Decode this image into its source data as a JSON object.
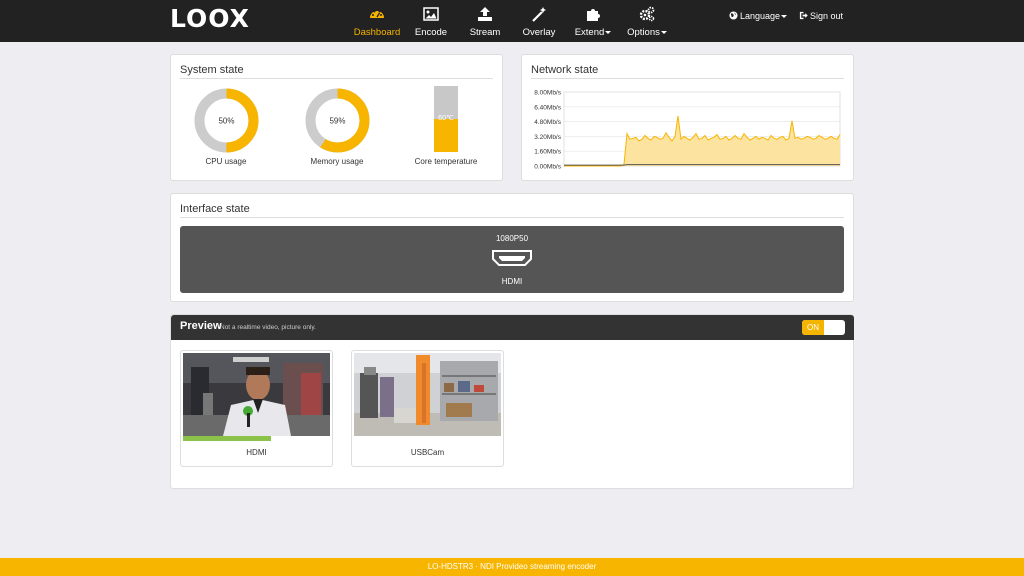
{
  "brand": "LOOX",
  "nav": {
    "items": [
      {
        "label": "Dashboard",
        "icon": "speedometer-icon",
        "active": true
      },
      {
        "label": "Encode",
        "icon": "image-icon"
      },
      {
        "label": "Stream",
        "icon": "upload-icon"
      },
      {
        "label": "Overlay",
        "icon": "magic-wand-icon"
      },
      {
        "label": "Extend",
        "icon": "puzzle-icon",
        "dropdown": true
      },
      {
        "label": "Options",
        "icon": "gears-icon",
        "dropdown": true
      }
    ],
    "language": "Language",
    "signout": "Sign out"
  },
  "system": {
    "title": "System state",
    "cpu": {
      "label": "CPU usage",
      "value": 50,
      "text": "50%"
    },
    "memory": {
      "label": "Memory usage",
      "value": 59,
      "text": "59%"
    },
    "temperature": {
      "label": "Core temperature",
      "text": "60℃",
      "level": 0.5
    }
  },
  "network": {
    "title": "Network state"
  },
  "chart_data": {
    "type": "area",
    "title": "",
    "ylim": [
      0,
      8
    ],
    "yticks": [
      "8.00Mb/s",
      "6.40Mb/s",
      "4.80Mb/s",
      "3.20Mb/s",
      "1.60Mb/s",
      "0.00Mb/s"
    ],
    "series": [
      {
        "color": "#f7b500",
        "values": [
          0,
          0,
          0,
          0,
          0,
          0,
          0,
          0,
          0,
          0,
          0,
          0,
          0,
          0,
          0,
          0,
          0,
          0,
          0,
          0,
          0.2,
          3.5,
          2.9,
          3.0,
          3.1,
          2.7,
          2.9,
          3.3,
          3.0,
          2.8,
          3.2,
          3.1,
          2.9,
          3.0,
          3.6,
          3.1,
          2.7,
          3.2,
          5.4,
          2.9,
          3.2,
          3.0,
          2.8,
          3.1,
          3.5,
          2.9,
          3.0,
          3.3,
          2.8,
          3.0,
          3.1,
          3.4,
          2.9,
          3.0,
          3.2,
          2.8,
          3.0,
          3.3,
          3.0,
          2.9,
          3.5,
          3.1,
          2.8,
          3.0,
          3.2,
          2.9,
          3.1,
          3.0,
          2.8,
          3.3,
          3.0,
          2.9,
          3.1,
          3.2,
          2.8,
          3.0,
          4.9,
          3.0,
          3.1,
          2.9,
          3.0,
          3.2,
          3.1,
          2.9,
          3.0,
          3.3,
          3.1,
          2.9,
          3.0,
          3.2,
          3.0,
          2.9,
          3.4
        ]
      },
      {
        "color": "#555555",
        "values": [
          0.1,
          0.1,
          0.1,
          0.1,
          0.1,
          0.1,
          0.1,
          0.1,
          0.1,
          0.1,
          0.1,
          0.1,
          0.1,
          0.1,
          0.1,
          0.1,
          0.1,
          0.1,
          0.1,
          0.1,
          0.1,
          0.15,
          0.15,
          0.15,
          0.15,
          0.15,
          0.15,
          0.15,
          0.15,
          0.15,
          0.15,
          0.15,
          0.15,
          0.15,
          0.15,
          0.15,
          0.15,
          0.15,
          0.15,
          0.15,
          0.15,
          0.15,
          0.15,
          0.15,
          0.15,
          0.15,
          0.15,
          0.15,
          0.15,
          0.15,
          0.15,
          0.15,
          0.15,
          0.15,
          0.15,
          0.15,
          0.15,
          0.15,
          0.15,
          0.15,
          0.15,
          0.15,
          0.15,
          0.15,
          0.15,
          0.15,
          0.15,
          0.15,
          0.15,
          0.15,
          0.15,
          0.15,
          0.15,
          0.15,
          0.15,
          0.15,
          0.15,
          0.15,
          0.15,
          0.15,
          0.15,
          0.15,
          0.15,
          0.15,
          0.15,
          0.15,
          0.15,
          0.15,
          0.15,
          0.15,
          0.15,
          0.15,
          0.15
        ]
      }
    ]
  },
  "interface": {
    "title": "Interface state",
    "resolution": "1080P50",
    "name": "HDMI"
  },
  "preview": {
    "title": "Preview",
    "subtitle": "Not a realtime video, picture only.",
    "toggle": "ON",
    "sources": [
      {
        "label": "HDMI",
        "progress": 0.6
      },
      {
        "label": "USBCam"
      }
    ]
  },
  "footer": "LO-HDSTR3 · NDI Provideo streaming encoder",
  "colors": {
    "accent": "#f7b500",
    "nav_bg": "#222222"
  }
}
